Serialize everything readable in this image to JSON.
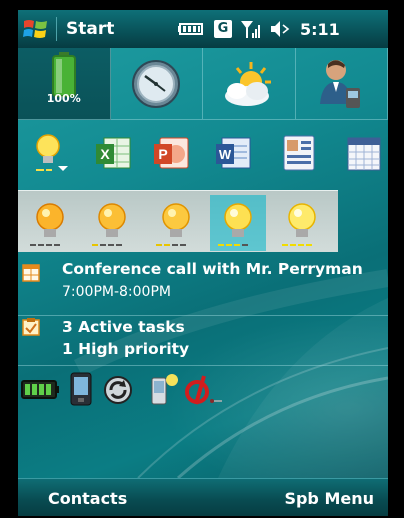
{
  "titlebar": {
    "title": "Start",
    "time": "5:11",
    "network_badge": "G",
    "icons": [
      "windows-flag-icon",
      "battery-icon",
      "network-g-icon",
      "signal-icon",
      "volume-icon"
    ]
  },
  "tiles": {
    "battery_percent": "100%",
    "icons": [
      "battery-status-icon",
      "clock-icon",
      "weather-icon",
      "contact-icon"
    ]
  },
  "apps": {
    "icons": [
      "bulb-profile-icon",
      "excel-icon",
      "powerpoint-icon",
      "word-icon",
      "contacts-card-icon",
      "calendar-icon"
    ]
  },
  "bulbs": {
    "count": 5,
    "selected_index": 3
  },
  "agenda": {
    "title": "Conference call with Mr. Perryman",
    "time": "7:00PM-8:00PM"
  },
  "tasks": {
    "line1": "3 Active tasks",
    "line2": "1 High priority"
  },
  "shortcuts": {
    "icons": [
      "battery-green-icon",
      "phone-device-icon",
      "sync-icon",
      "bluetooth-device-icon",
      "disconnect-icon"
    ]
  },
  "softkeys": {
    "left": "Contacts",
    "right": "Spb Menu"
  },
  "colors": {
    "accent": "#0b7d84",
    "titlebar": "#09535a",
    "bulb_panel": "#c5d2d0",
    "selected_bulb": "#3fc1cf"
  }
}
